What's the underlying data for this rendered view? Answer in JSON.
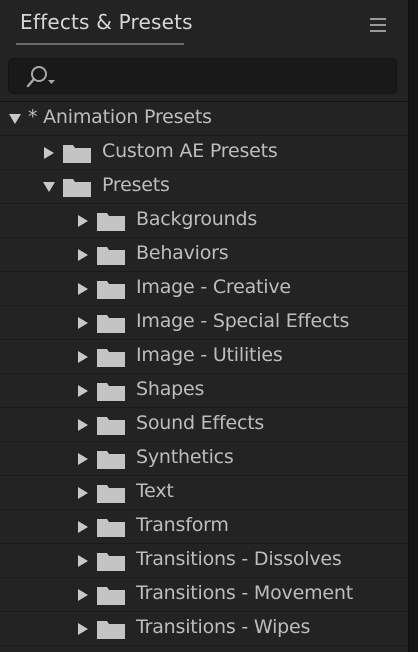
{
  "panel": {
    "title": "Effects & Presets",
    "menu_icon": "hamburger-menu-icon",
    "search": {
      "icon": "search-dropdown-icon",
      "value": "",
      "placeholder": ""
    }
  },
  "tree": {
    "root": {
      "label": "* Animation Presets",
      "expanded": true
    },
    "children": [
      {
        "label": "Custom AE Presets",
        "expanded": false
      },
      {
        "label": "Presets",
        "expanded": true
      }
    ],
    "presets": [
      {
        "label": "Backgrounds"
      },
      {
        "label": "Behaviors"
      },
      {
        "label": "Image - Creative"
      },
      {
        "label": "Image - Special Effects"
      },
      {
        "label": "Image - Utilities"
      },
      {
        "label": "Shapes"
      },
      {
        "label": "Sound Effects"
      },
      {
        "label": "Synthetics"
      },
      {
        "label": "Text"
      },
      {
        "label": "Transform"
      },
      {
        "label": "Transitions - Dissolves"
      },
      {
        "label": "Transitions - Movement"
      },
      {
        "label": "Transitions - Wipes"
      }
    ]
  },
  "colors": {
    "background": "#232323",
    "text": "#bdbdbd",
    "folder": "#c4c4c4",
    "triangle": "#c8c8c8"
  }
}
